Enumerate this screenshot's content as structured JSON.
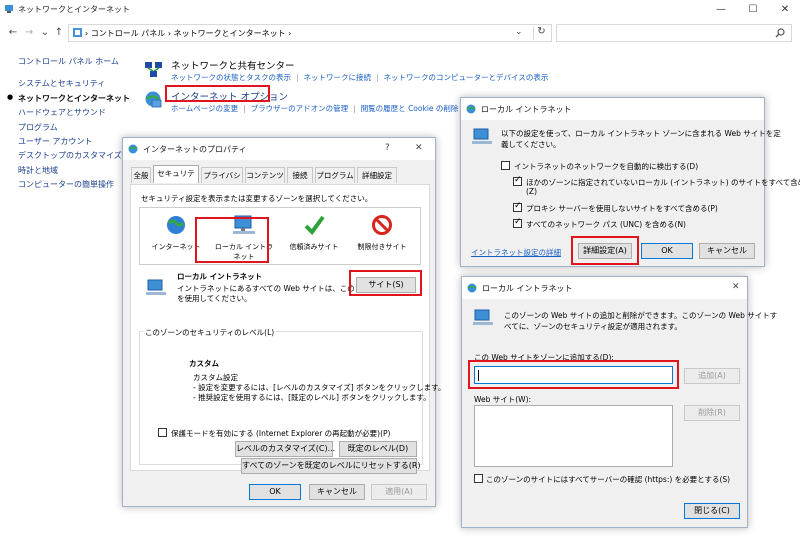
{
  "window": {
    "title": "ネットワークとインターネット",
    "minimize": "—",
    "maximize": "☐",
    "close": "✕"
  },
  "addressbar": {
    "back": "←",
    "forward": "→",
    "recent": "⌄",
    "up": "↑",
    "path": "› コントロール パネル › ネットワークとインターネット ›",
    "dropdown": "⌄",
    "refresh": "↻"
  },
  "leftnav": {
    "items": [
      "コントロール パネル ホーム",
      "システムとセキュリティ",
      "ネットワークとインターネット",
      "ハードウェアとサウンド",
      "プログラム",
      "ユーザー アカウント",
      "デスクトップのカスタマイズ",
      "時計と地域",
      "コンピューターの簡単操作"
    ],
    "active_index": 2
  },
  "sections": {
    "network_center": {
      "title": "ネットワークと共有センター",
      "links": [
        "ネットワークの状態とタスクの表示",
        "ネットワークに接続",
        "ネットワークのコンピューターとデバイスの表示"
      ]
    },
    "internet_options": {
      "title": "インターネット オプション",
      "links": [
        "ホームページの変更",
        "ブラウザーのアドオンの管理",
        "閲覧の履歴と Cookie の削除"
      ]
    }
  },
  "props_dialog": {
    "title": "インターネットのプロパティ",
    "help": "?",
    "close": "✕",
    "tabs": [
      "全般",
      "セキュリティ",
      "プライバシー",
      "コンテンツ",
      "接続",
      "プログラム",
      "詳細設定"
    ],
    "active_tab": 1,
    "prompt": "セキュリティ設定を表示または変更するゾーンを選択してください。",
    "zones": [
      "インターネット",
      "ローカル イントラネット",
      "信頼済みサイト",
      "制限付きサイト"
    ],
    "zone_title": "ローカル イントラネット",
    "zone_desc_1": "イントラネットにあるすべての Web サイトは、このゾーン",
    "zone_desc_2": "を使用してください。",
    "sites_btn": "サイト(S)",
    "level_group": "このゾーンのセキュリティのレベル(L)",
    "level_name": "カスタム",
    "level_lines": [
      "カスタム設定",
      "- 設定を変更するには、[レベルのカスタマイズ] ボタンをクリックします。",
      "- 推奨設定を使用するには、[既定のレベル] ボタンをクリックします。"
    ],
    "protected_mode": "保護モードを有効にする (Internet Explorer の再起動が必要)(P)",
    "custom_level_btn": "レベルのカスタマイズ(C)...",
    "default_level_btn": "既定のレベル(D)",
    "reset_all_btn": "すべてのゾーンを既定のレベルにリセットする(R)",
    "ok": "OK",
    "cancel": "キャンセル",
    "apply": "適用(A)"
  },
  "intranet_dialog": {
    "title": "ローカル イントラネット",
    "desc_1": "以下の設定を使って、ローカル イントラネット ゾーンに含まれる Web サイトを定",
    "desc_2": "義してください。",
    "checks": [
      {
        "label": "イントラネットのネットワークを自動的に検出する(D)",
        "checked": false
      },
      {
        "label": "ほかのゾーンに指定されていないローカル (イントラネット) のサイトをすべて含める",
        "label2": "(Z)",
        "checked": true
      },
      {
        "label": "プロキシ サーバーを使用しないサイトをすべて含める(P)",
        "checked": true
      },
      {
        "label": "すべてのネットワーク パス (UNC) を含める(N)",
        "checked": true
      }
    ],
    "help_link": "イントラネット設定の詳細",
    "advanced_btn": "詳細設定(A)",
    "ok": "OK",
    "cancel": "キャンセル"
  },
  "sites_dialog": {
    "title": "ローカル イントラネット",
    "close": "✕",
    "desc_1": "このゾーンの Web サイトの追加と削除ができます。このゾーンの Web サイトす",
    "desc_2": "べてに、ゾーンのセキュリティ設定が適用されます。",
    "add_label": "この Web サイトをゾーンに追加する(D):",
    "add_value": "",
    "add_btn": "追加(A)",
    "list_label": "Web サイト(W):",
    "remove_btn": "削除(R)",
    "https_check": "このゾーンのサイトにはすべてサーバーの確認 (https:) を必要とする(S)",
    "close_btn": "閉じる(C)"
  },
  "colors": {
    "highlight": "#e0141c",
    "link": "#1a5fc8",
    "nav_link": "#1a3f8c",
    "dialog_bg": "#f0f0f0"
  }
}
